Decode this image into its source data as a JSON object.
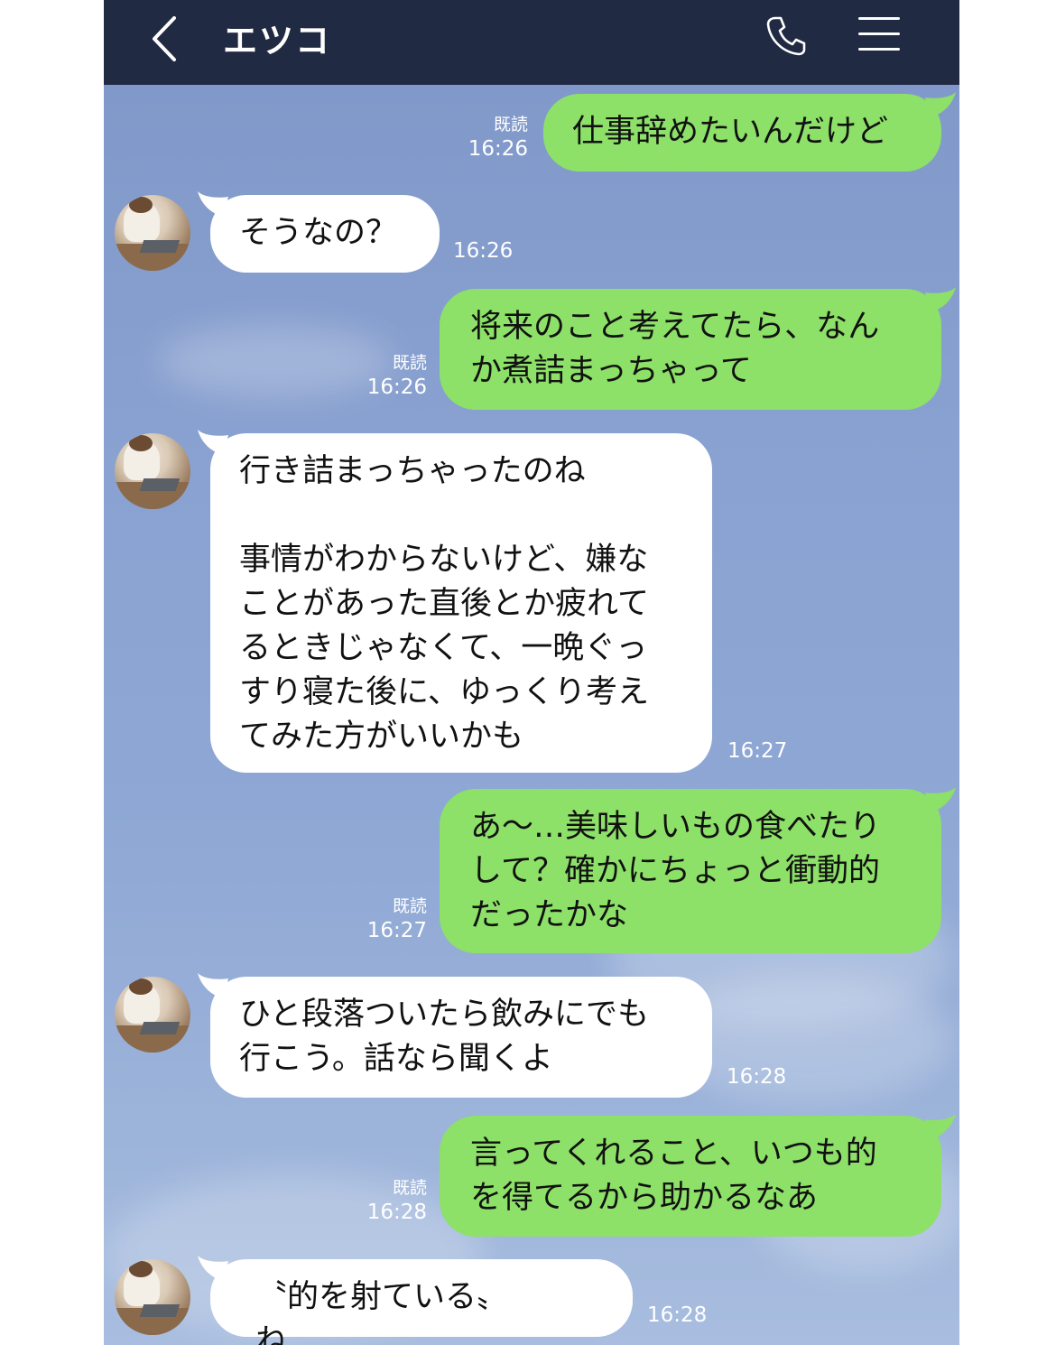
{
  "header": {
    "title": "エツコ",
    "icons": [
      "back-chevron-icon",
      "phone-icon",
      "menu-icon"
    ],
    "bg": "#212a43"
  },
  "colors": {
    "outgoing_bubble": "#8de068",
    "incoming_bubble": "#ffffff",
    "background": "#8aa2d1"
  },
  "messages": [
    {
      "side": "right",
      "text": "仕事辞めたいんだけど",
      "read": "既読",
      "time": "16:26"
    },
    {
      "side": "left",
      "text": "そうなの？",
      "time": "16:26"
    },
    {
      "side": "right",
      "text": "将来のこと考えてたら、なん\nか煮詰まっちゃって",
      "read": "既読",
      "time": "16:26"
    },
    {
      "side": "left",
      "text": "行き詰まっちゃったのね\n\n事情がわからないけど、嫌な\nことがあった直後とか疲れて\nるときじゃなくて、一晩ぐっ\nすり寝た後に、ゆっくり考え\nてみた方がいいかも",
      "time": "16:27"
    },
    {
      "side": "right",
      "text": "あ〜…美味しいもの食べたり\nして？確かにちょっと衝動的\nだったかな",
      "read": "既読",
      "time": "16:27"
    },
    {
      "side": "left",
      "text": "ひと段落ついたら飲みにでも\n行こう。話なら聞くよ",
      "time": "16:28"
    },
    {
      "side": "right",
      "text": "言ってくれること、いつも的\nを得てるから助かるなあ",
      "read": "既読",
      "time": "16:28"
    },
    {
      "side": "left",
      "text": "〝的を射ている〟ね……",
      "time": "16:28"
    }
  ]
}
